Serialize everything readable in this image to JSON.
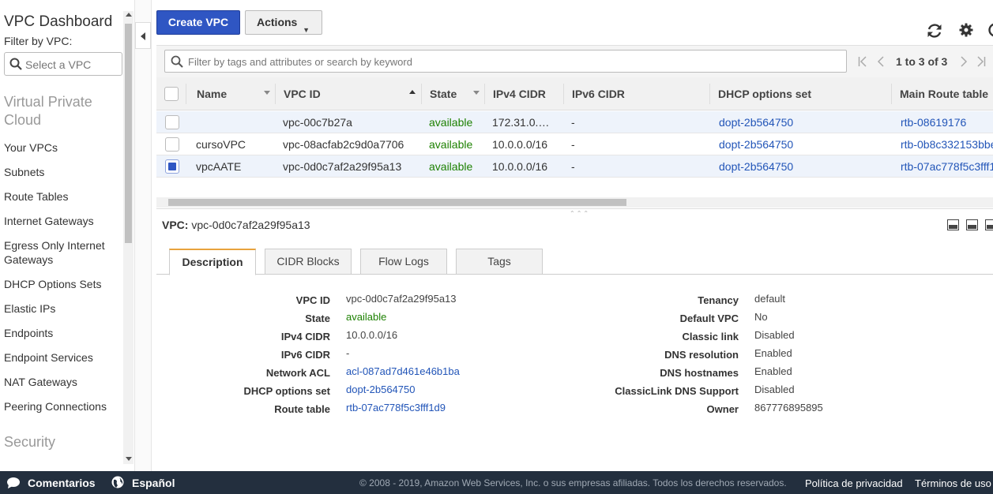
{
  "sidebar": {
    "title": "VPC Dashboard",
    "filter_label": "Filter by VPC:",
    "select_placeholder": "Select a VPC",
    "section_vpc": "Virtual Private Cloud",
    "items": [
      "Your VPCs",
      "Subnets",
      "Route Tables",
      "Internet Gateways",
      "Egress Only Internet Gateways",
      "DHCP Options Sets",
      "Elastic IPs",
      "Endpoints",
      "Endpoint Services",
      "NAT Gateways",
      "Peering Connections"
    ],
    "section_security": "Security"
  },
  "toolbar": {
    "create_label": "Create VPC",
    "actions_label": "Actions",
    "refresh_icon": "refresh-icon",
    "settings_icon": "gear-icon",
    "help_icon": "help-icon"
  },
  "search": {
    "placeholder": "Filter by tags and attributes or search by keyword",
    "pagination": "1 to 3 of 3"
  },
  "table": {
    "columns": [
      "Name",
      "VPC ID",
      "State",
      "IPv4 CIDR",
      "IPv6 CIDR",
      "DHCP options set",
      "Main Route table"
    ],
    "rows": [
      {
        "name": "",
        "vpc_id": "vpc-00c7b27a",
        "state": "available",
        "ipv4": "172.31.0.…",
        "ipv6": "-",
        "dhcp": "dopt-2b564750",
        "route": "rtb-08619176",
        "checked": false
      },
      {
        "name": "cursoVPC",
        "vpc_id": "vpc-08acfab2c9d0a7706",
        "state": "available",
        "ipv4": "10.0.0.0/16",
        "ipv6": "-",
        "dhcp": "dopt-2b564750",
        "route": "rtb-0b8c332153bbe",
        "checked": false
      },
      {
        "name": "vpcAATE",
        "vpc_id": "vpc-0d0c7af2a29f95a13",
        "state": "available",
        "ipv4": "10.0.0.0/16",
        "ipv6": "-",
        "dhcp": "dopt-2b564750",
        "route": "rtb-07ac778f5c3fff1",
        "checked": true
      }
    ]
  },
  "detail": {
    "header_label": "VPC:",
    "header_value": "vpc-0d0c7af2a29f95a13",
    "tabs": [
      "Description",
      "CIDR Blocks",
      "Flow Logs",
      "Tags"
    ],
    "left": [
      {
        "label": "VPC ID",
        "value": "vpc-0d0c7af2a29f95a13"
      },
      {
        "label": "State",
        "value": "available"
      },
      {
        "label": "IPv4 CIDR",
        "value": "10.0.0.0/16"
      },
      {
        "label": "IPv6 CIDR",
        "value": "-"
      },
      {
        "label": "Network ACL",
        "value": "acl-087ad7d461e46b1ba"
      },
      {
        "label": "DHCP options set",
        "value": "dopt-2b564750"
      },
      {
        "label": "Route table",
        "value": "rtb-07ac778f5c3fff1d9"
      }
    ],
    "right": [
      {
        "label": "Tenancy",
        "value": "default"
      },
      {
        "label": "Default VPC",
        "value": "No"
      },
      {
        "label": "Classic link",
        "value": "Disabled"
      },
      {
        "label": "DNS resolution",
        "value": "Enabled"
      },
      {
        "label": "DNS hostnames",
        "value": "Enabled"
      },
      {
        "label": "ClassicLink DNS Support",
        "value": "Disabled"
      },
      {
        "label": "Owner",
        "value": "867776895895"
      }
    ]
  },
  "footer": {
    "feedback": "Comentarios",
    "language": "Español",
    "copyright": "© 2008 - 2019, Amazon Web Services, Inc. o sus empresas afiliadas. Todos los derechos reservados.",
    "privacy": "Política de privacidad",
    "terms": "Términos de uso"
  },
  "colors": {
    "primary_button": "#2f56c3",
    "status_green": "#1d8102",
    "link_blue": "#2255b8",
    "footer_bg": "#232f3e",
    "tab_accent": "#e8a33d"
  }
}
